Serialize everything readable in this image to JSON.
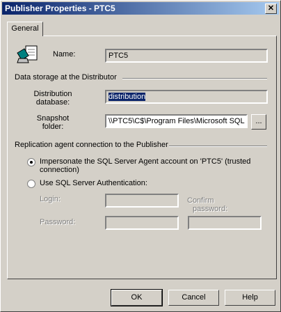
{
  "window": {
    "title": "Publisher Properties - PTC5",
    "close_glyph": "✕"
  },
  "tabs": [
    {
      "label": "General"
    }
  ],
  "publisher": {
    "name_label": "Name:",
    "name_value": "PTC5"
  },
  "data_storage": {
    "section_label": "Data storage at the Distributor",
    "distribution_database_label_1": "Distribution",
    "distribution_database_label_2": "database:",
    "distribution_database_value": "distribution",
    "snapshot_folder_label_1": "Snapshot",
    "snapshot_folder_label_2": "folder:",
    "snapshot_folder_value": "\\\\PTC5\\C$\\Program Files\\Microsoft SQL",
    "browse_label": "..."
  },
  "agent_connection": {
    "section_label": "Replication agent connection to the Publisher",
    "impersonate_label_1": "Impersonate the SQL Server Agent account on 'PTC5' (trusted",
    "impersonate_label_2": "connection)",
    "sql_auth_label": "Use SQL Server Authentication:",
    "selected": "impersonate",
    "login_label": "Login:",
    "password_label": "Password:",
    "confirm_password_label_1": "Confirm",
    "confirm_password_label_2": "password:"
  },
  "buttons": {
    "ok": "OK",
    "cancel": "Cancel",
    "help": "Help"
  }
}
